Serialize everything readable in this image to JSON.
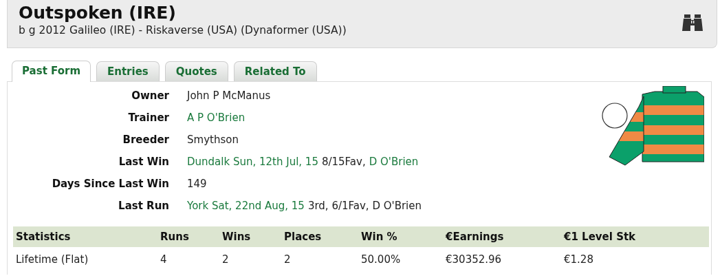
{
  "header": {
    "title": "Outspoken (IRE)",
    "pedigree": "b g 2012 Galileo (IRE) - Riskaverse (USA) (Dynaformer (USA))"
  },
  "tabs": [
    {
      "label": "Past Form",
      "selected": true
    },
    {
      "label": "Entries",
      "selected": false
    },
    {
      "label": "Quotes",
      "selected": false
    },
    {
      "label": "Related To",
      "selected": false
    }
  ],
  "details": [
    {
      "label": "Owner",
      "parts": [
        {
          "text": "John P McManus",
          "kind": "text"
        }
      ]
    },
    {
      "label": "Trainer",
      "parts": [
        {
          "text": "A P O'Brien",
          "kind": "link"
        }
      ]
    },
    {
      "label": "Breeder",
      "parts": [
        {
          "text": "Smythson",
          "kind": "text"
        }
      ]
    },
    {
      "label": "Last Win",
      "parts": [
        {
          "text": "Dundalk Sun, 12th Jul, 15",
          "kind": "link"
        },
        {
          "text": "8/15Fav,",
          "kind": "text"
        },
        {
          "text": "D O'Brien",
          "kind": "link"
        }
      ]
    },
    {
      "label": "Days Since Last Win",
      "parts": [
        {
          "text": "149",
          "kind": "text"
        }
      ]
    },
    {
      "label": "Last Run",
      "parts": [
        {
          "text": "York Sat, 22nd Aug, 15",
          "kind": "link"
        },
        {
          "text": "3rd, 6/1Fav, D O'Brien",
          "kind": "text"
        }
      ]
    }
  ],
  "statistics": {
    "columns": [
      "Statistics",
      "Runs",
      "Wins",
      "Places",
      "Win %",
      "€Earnings",
      "€1 Level Stk"
    ],
    "rows": [
      [
        "Lifetime (Flat)",
        "4",
        "2",
        "2",
        "50.00%",
        "€30352.96",
        "€1.28"
      ]
    ]
  }
}
